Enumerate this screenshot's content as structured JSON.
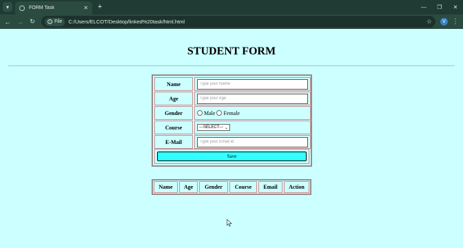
{
  "browser": {
    "tab_title": "FORM Task",
    "tab_close": "✕",
    "new_tab": "+",
    "file_label": "File",
    "url": "C:/Users/ELCOT/Desktop/linked%20task/html.html",
    "avatar_letter": "V"
  },
  "page": {
    "title": "STUDENT FORM"
  },
  "form": {
    "name_label": "Name",
    "name_placeholder": "Type your Name",
    "age_label": "Age",
    "age_placeholder": "Type your Age",
    "gender_label": "Gender",
    "gender_options": [
      "Male",
      "Female"
    ],
    "course_label": "Course",
    "course_selected": "---SELECT---",
    "email_label": "E-Mail",
    "email_placeholder": "Type your Email id",
    "save_label": "Save"
  },
  "table": {
    "headers": [
      "Name",
      "Age",
      "Gender",
      "Course",
      "Email",
      "Action"
    ]
  }
}
